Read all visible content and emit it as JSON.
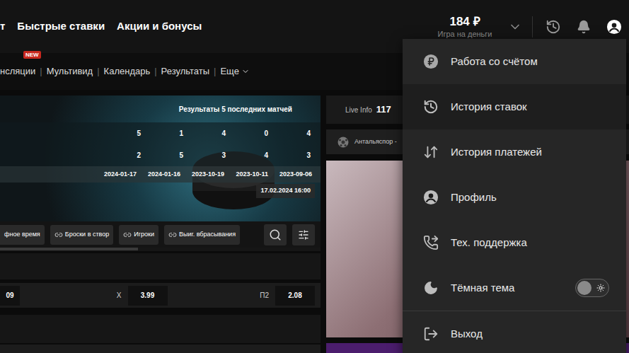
{
  "topnav": {
    "items": [
      "т",
      "Быстрые ставки",
      "Акции и бонусы"
    ]
  },
  "balance": {
    "amount": "184 ₽",
    "mode": "Игра на деньги"
  },
  "subnav": {
    "items": [
      {
        "label": "нсляции",
        "badge": "NEW"
      },
      {
        "label": "Мультивид",
        "badge": ""
      },
      {
        "label": "Календарь",
        "badge": ""
      },
      {
        "label": "Результаты",
        "badge": ""
      }
    ],
    "separator": "|",
    "more": "Еще"
  },
  "match": {
    "title": "Результаты 5 последних матчей",
    "rows": [
      [
        "5",
        "1",
        "4",
        "0",
        "4"
      ],
      [
        "2",
        "5",
        "3",
        "4",
        "3"
      ]
    ],
    "dates": [
      "2024-01-17",
      "2024-01-16",
      "2023-10-19",
      "2023-10-11",
      "2023-09-06"
    ],
    "datetime": "17.02.2024 16:00"
  },
  "filters": {
    "chips": [
      "фное время",
      "Броски в створ",
      "Игроки",
      "Выиг. вбрасывания"
    ],
    "scroll_level": 0.43
  },
  "odds": [
    {
      "label": "",
      "value": "09"
    },
    {
      "label": "X",
      "value": "3.99"
    },
    {
      "label": "П2",
      "value": "2.08"
    }
  ],
  "live": {
    "label": "Live Info",
    "count": "117",
    "match": "Антальяспор -"
  },
  "menu": {
    "items": [
      {
        "label": "Работа со счётом",
        "kind": "link",
        "selected": false
      },
      {
        "label": "История ставок",
        "kind": "link",
        "selected": true
      },
      {
        "label": "История платежей",
        "kind": "link",
        "selected": false
      },
      {
        "label": "Профиль",
        "kind": "link",
        "selected": false
      },
      {
        "label": "Тех. поддержка",
        "kind": "link",
        "selected": false
      },
      {
        "label": "Тёмная тема",
        "kind": "toggle",
        "selected": false,
        "on": false
      },
      {
        "label": "Выход",
        "kind": "link",
        "selected": false
      }
    ]
  }
}
